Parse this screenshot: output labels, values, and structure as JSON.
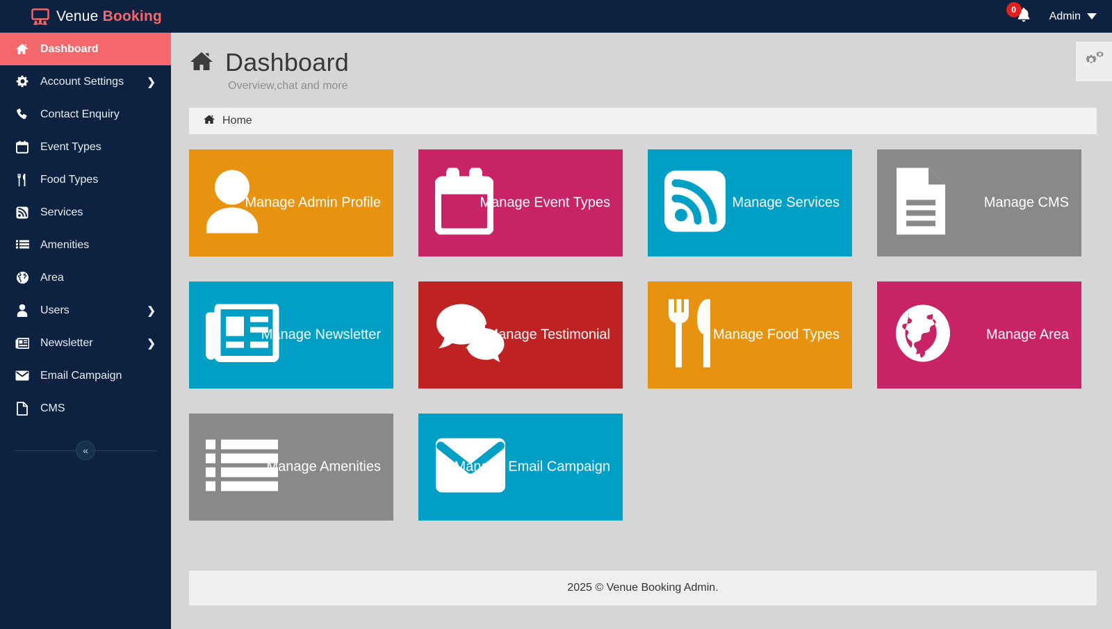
{
  "brand": {
    "name_regular": "Venue ",
    "name_bold": "Booking",
    "icon": "presentation-screen-icon"
  },
  "topbar": {
    "notification_count": "0",
    "bell_icon": "bell-icon",
    "user_label": "Admin",
    "caret_icon": "chevron-down-icon"
  },
  "sidebar": {
    "items": [
      {
        "label": "Dashboard",
        "icon": "home-icon",
        "active": true,
        "arrow": ""
      },
      {
        "label": "Account Settings",
        "icon": "gear-icon",
        "active": false,
        "arrow": "❯"
      },
      {
        "label": "Contact Enquiry",
        "icon": "phone-icon",
        "active": false,
        "arrow": ""
      },
      {
        "label": "Event Types",
        "icon": "calendar-icon",
        "active": false,
        "arrow": ""
      },
      {
        "label": "Food Types",
        "icon": "cutlery-icon",
        "active": false,
        "arrow": ""
      },
      {
        "label": "Services",
        "icon": "rss-icon",
        "active": false,
        "arrow": ""
      },
      {
        "label": "Amenities",
        "icon": "list-icon",
        "active": false,
        "arrow": ""
      },
      {
        "label": "Area",
        "icon": "globe-icon",
        "active": false,
        "arrow": ""
      },
      {
        "label": "Users",
        "icon": "user-icon",
        "active": false,
        "arrow": "❯"
      },
      {
        "label": "Newsletter",
        "icon": "newspaper-icon",
        "active": false,
        "arrow": "❯"
      },
      {
        "label": "Email Campaign",
        "icon": "envelope-icon",
        "active": false,
        "arrow": ""
      },
      {
        "label": "CMS",
        "icon": "file-icon",
        "active": false,
        "arrow": ""
      }
    ],
    "collapse_label": "«",
    "collapse_icon": "double-chevron-left-icon"
  },
  "page": {
    "title": "Dashboard",
    "title_icon": "home-icon",
    "subtitle": "Overview,chat and more",
    "settings_icon": "cogs-icon"
  },
  "breadcrumb": {
    "icon": "home-icon",
    "label": "Home"
  },
  "tiles": [
    {
      "label": "Manage Admin Profile",
      "color": "#e8930f",
      "icon": "user-icon"
    },
    {
      "label": "Manage Event Types",
      "color": "#c72366",
      "icon": "calendar-icon"
    },
    {
      "label": "Manage Services",
      "color": "#00a0c6",
      "icon": "rss-square-icon"
    },
    {
      "label": "Manage CMS",
      "color": "#898989",
      "icon": "file-text-icon"
    },
    {
      "label": "Manage Newsletter",
      "color": "#00a0c6",
      "icon": "newspaper-icon"
    },
    {
      "label": "Manage Testimonial",
      "color": "#be2222",
      "icon": "comments-icon"
    },
    {
      "label": "Manage Food Types",
      "color": "#e8930f",
      "icon": "cutlery-icon"
    },
    {
      "label": "Manage Area",
      "color": "#c72366",
      "icon": "globe-icon"
    },
    {
      "label": "Manage Amenities",
      "color": "#898989",
      "icon": "list-icon"
    },
    {
      "label": "Manage Email Campaign",
      "color": "#00a0c6",
      "icon": "envelope-icon"
    }
  ],
  "footer": {
    "text": "2025 © Venue Booking Admin."
  },
  "colors": {
    "sidebar_bg": "#0d2240",
    "accent_coral": "#f4676b",
    "orange": "#e8930f",
    "magenta": "#c72366",
    "cyan": "#00a0c6",
    "gray": "#898989",
    "red": "#be2222",
    "badge_red": "#e02020"
  }
}
